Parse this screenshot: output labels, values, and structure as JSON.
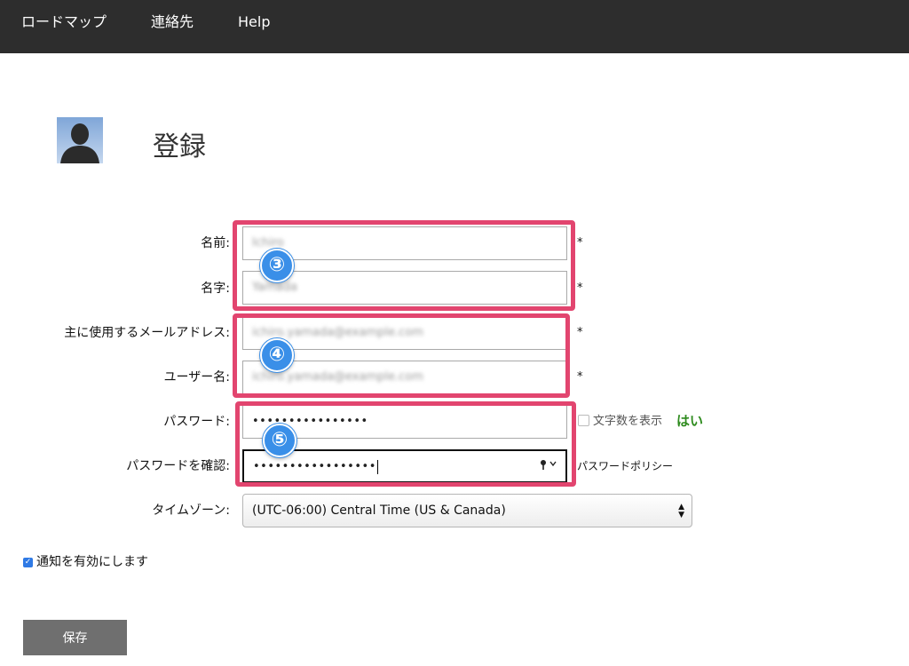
{
  "nav": {
    "items": [
      {
        "label": "ロードマップ"
      },
      {
        "label": "連絡先"
      },
      {
        "label": "Help"
      }
    ]
  },
  "page": {
    "title": "登録"
  },
  "form": {
    "first_name": {
      "label": "名前:",
      "value": "Ichiro"
    },
    "last_name": {
      "label": "名字:",
      "value": "Yamada"
    },
    "email": {
      "label": "主に使用するメールアドレス:",
      "value": "ichiro.yamada@example.com"
    },
    "username": {
      "label": "ユーザー名:",
      "value": "ichiro.yamada@example.com"
    },
    "password": {
      "label": "パスワード:",
      "value": "••••••••••••••••"
    },
    "password_confirm": {
      "label": "パスワードを確認:",
      "value": "•••••••••••••••••"
    },
    "timezone": {
      "label": "タイムゾーン:",
      "value": "(UTC-06:00) Central Time (US & Canada)"
    },
    "required_mark": "*",
    "show_char_count": "文字数を表示",
    "yes": "はい",
    "password_policy": "パスワードポリシー",
    "notify_label": "通知を有効にします",
    "save_label": "保存"
  },
  "annotations": {
    "box1": "③",
    "box2": "④",
    "box3": "⑤"
  },
  "colors": {
    "topbar": "#2d2d2d",
    "highlight": "#e2456f",
    "badge": "#3a8fe8",
    "yes_text": "#2e8b1e",
    "save_button": "#6f6f6f"
  }
}
